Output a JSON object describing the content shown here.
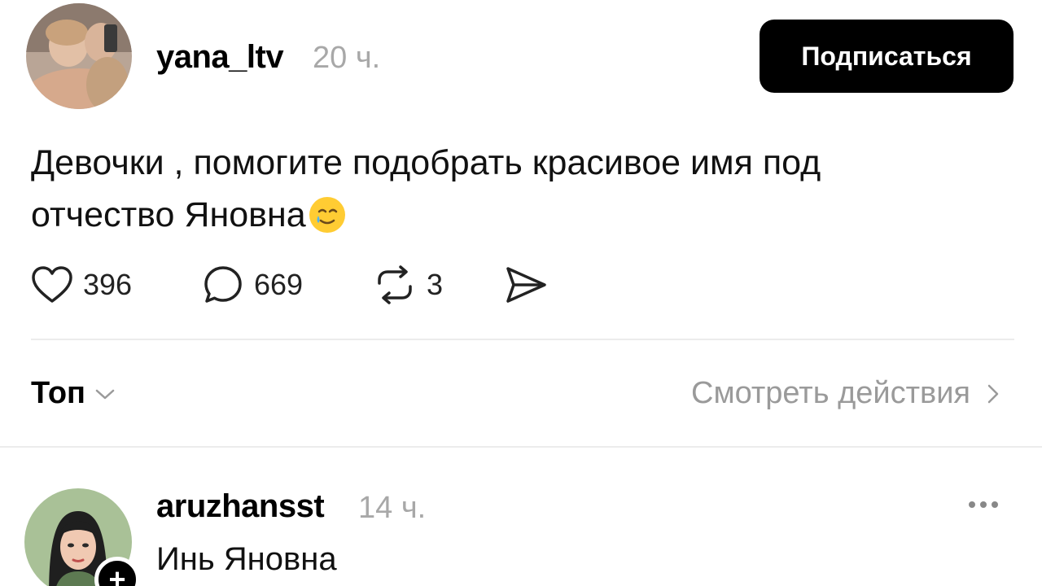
{
  "post": {
    "username": "yana_ltv",
    "time": "20 ч.",
    "follow_label": "Подписаться",
    "text_line1": "Девочки , помогите подобрать красивое имя под",
    "text_line2": "отчество Яновна",
    "emoji": "smiling-face-with-tear-emoji",
    "likes": "396",
    "comments": "669",
    "reposts": "3"
  },
  "sort": {
    "label": "Топ",
    "activity_label": "Смотреть действия"
  },
  "comment": {
    "username": "aruzhansst",
    "time": "14 ч.",
    "text": "Инь Яновна"
  }
}
